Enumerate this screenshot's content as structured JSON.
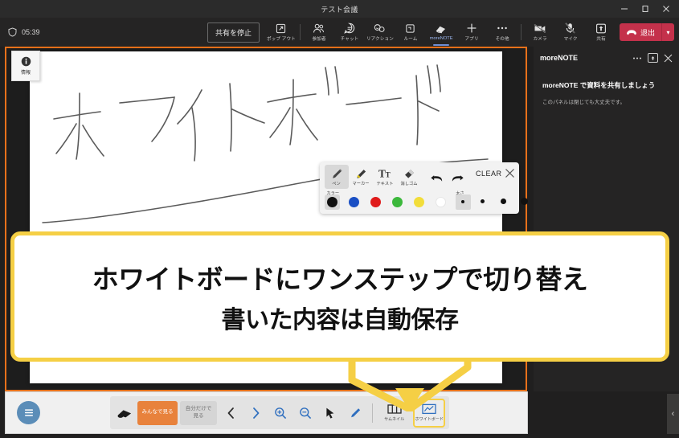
{
  "window": {
    "title": "テスト会議",
    "minimize_label": "minimize",
    "maximize_label": "maximize",
    "close_label": "close"
  },
  "meeting_toolbar": {
    "timer": "05:39",
    "stop_share_label": "共有を停止",
    "items": [
      {
        "label": "ポップ アウト",
        "icon": "popout-icon"
      },
      {
        "label": "参加者",
        "icon": "people-icon"
      },
      {
        "label": "チャット",
        "icon": "chat-icon"
      },
      {
        "label": "リアクション",
        "icon": "reactions-icon"
      },
      {
        "label": "ルーム",
        "icon": "breakout-rooms-icon"
      },
      {
        "label": "moreNOTE",
        "icon": "morenote-icon",
        "active": true
      },
      {
        "label": "アプリ",
        "icon": "plus-icon"
      },
      {
        "label": "その他",
        "icon": "more-icon"
      }
    ],
    "device_items": [
      {
        "label": "カメラ",
        "icon": "camera-off-icon"
      },
      {
        "label": "マイク",
        "icon": "mic-off-icon"
      },
      {
        "label": "共有",
        "icon": "share-icon"
      }
    ],
    "leave_label": "退出",
    "leave_color": "#c4314b"
  },
  "share_area": {
    "border_color": "#e8711a",
    "info_badge_label": "情報",
    "whiteboard_handwriting": "ホワイトボード"
  },
  "pen_toolbar": {
    "tools": [
      {
        "label": "ペン",
        "icon": "pen-icon",
        "selected": true
      },
      {
        "label": "マーカー",
        "icon": "marker-icon",
        "selected": false
      },
      {
        "label": "テキスト",
        "icon": "text-icon",
        "selected": false
      },
      {
        "label": "消しゴム",
        "icon": "eraser-icon",
        "selected": false
      }
    ],
    "undo_label": "undo-icon",
    "redo_label": "redo-icon",
    "clear_label": "CLEAR",
    "close_label": "close-icon",
    "color_caption": "カラー",
    "colors": [
      {
        "name": "black",
        "hex": "#111111",
        "selected": true
      },
      {
        "name": "blue",
        "hex": "#1a4fc4",
        "selected": false
      },
      {
        "name": "red",
        "hex": "#e01b1b",
        "selected": false
      },
      {
        "name": "green",
        "hex": "#3cb83c",
        "selected": false
      },
      {
        "name": "yellow",
        "hex": "#f2dd3a",
        "selected": false
      },
      {
        "name": "white",
        "hex": "#ffffff",
        "selected": false
      }
    ],
    "thickness_caption": "太さ",
    "thickness": [
      {
        "size": 3,
        "selected": true
      },
      {
        "size": 5,
        "selected": false
      },
      {
        "size": 7,
        "selected": false
      },
      {
        "size": 10,
        "selected": false
      }
    ]
  },
  "side_panel": {
    "title": "moreNOTE",
    "more_label": "more-icon",
    "popout_label": "popout-icon",
    "close_label": "close-icon",
    "heading": "moreNOTE で資料を共有しましょう",
    "subtext": "このパネルは閉じても大丈夫です。"
  },
  "bottom_bar": {
    "menu_label": "hamburger-menu-icon",
    "presenter_icon": "presenter-icon",
    "view_all_label": "みんなで見る",
    "view_self_label": "自分だけで\n見る",
    "prev_label": "prev-page-icon",
    "next_label": "next-page-icon",
    "zoom_in_label": "zoom-in-icon",
    "zoom_out_label": "zoom-out-icon",
    "pointer_label": "pointer-icon",
    "pen_label": "pen-icon",
    "thumbnail_label": "サムネイル",
    "whiteboard_label": "ホワイトボード",
    "collapse_label": "‹",
    "accent_color": "#e8823c",
    "highlight_color": "#f5cf45"
  },
  "callout": {
    "line1": "ホワイトボードにワンステップで切り替え",
    "line2": "書いた内容は自動保存",
    "border_color": "#f5cf45"
  }
}
